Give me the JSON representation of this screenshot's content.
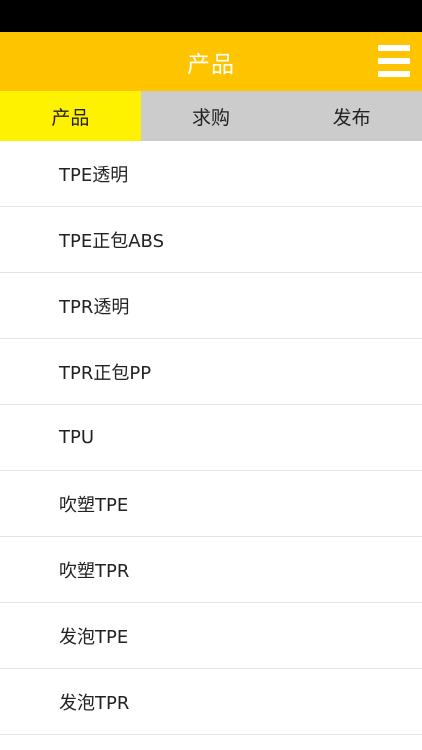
{
  "header": {
    "title": "产品"
  },
  "tabs": [
    {
      "label": "产品",
      "active": true
    },
    {
      "label": "求购",
      "active": false
    },
    {
      "label": "发布",
      "active": false
    }
  ],
  "list": {
    "items": [
      "TPE透明",
      "TPE正包ABS",
      "TPR透明",
      "TPR正包PP",
      "TPU",
      "吹塑TPE",
      "吹塑TPR",
      "发泡TPE",
      "发泡TPR"
    ]
  },
  "colors": {
    "header": "#FFC400",
    "active_tab": "#FFF200",
    "inactive_tabs": "#CCCCCC",
    "status_bar": "#000000"
  },
  "icons": {
    "menu": "hamburger-menu-icon"
  }
}
